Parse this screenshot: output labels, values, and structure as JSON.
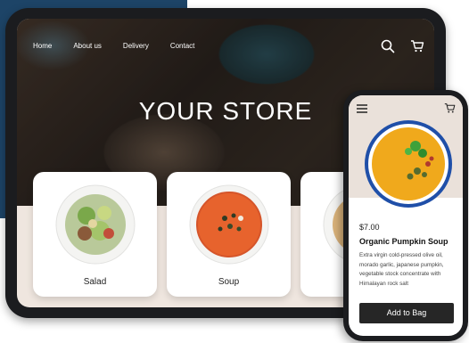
{
  "nav": {
    "items": [
      "Home",
      "About us",
      "Delivery",
      "Contact"
    ]
  },
  "hero": {
    "title": "YOUR STORE"
  },
  "cards": [
    {
      "label": "Salad"
    },
    {
      "label": "Soup"
    },
    {
      "label": ""
    }
  ],
  "product": {
    "price": "$7.00",
    "name": "Organic Pumpkin Soup",
    "description": "Extra virgin cold-pressed olive oil, morado garlic, japanese pumpkin, vegetable stock concentrate with Himalayan rock salt",
    "button_label": "Add to Bag"
  },
  "icons": {
    "search": "search-icon",
    "cart": "cart-icon",
    "menu": "hamburger-menu-icon"
  },
  "colors": {
    "brand_navy": "#1d4467",
    "button_dark": "#262626",
    "device_frame": "#1b1c1f",
    "cream": "#efe6df"
  }
}
